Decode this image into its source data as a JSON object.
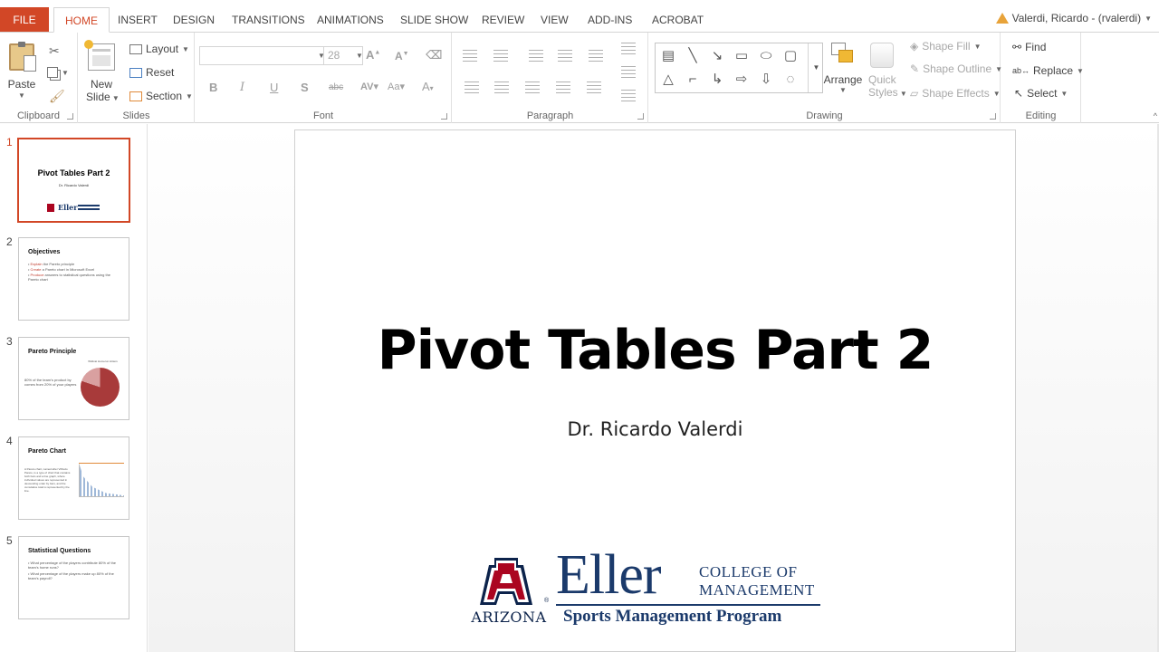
{
  "tabs": {
    "file": "FILE",
    "items": [
      "HOME",
      "INSERT",
      "DESIGN",
      "TRANSITIONS",
      "ANIMATIONS",
      "SLIDE SHOW",
      "REVIEW",
      "VIEW",
      "ADD-INS",
      "ACROBAT"
    ],
    "active": "HOME"
  },
  "user": {
    "name": "Valerdi, Ricardo - (rvalerdi)"
  },
  "ribbon": {
    "clipboard": {
      "label": "Clipboard",
      "paste": "Paste"
    },
    "slides": {
      "label": "Slides",
      "new_slide_line1": "New",
      "new_slide_line2": "Slide",
      "layout": "Layout",
      "reset": "Reset",
      "section": "Section"
    },
    "font": {
      "label": "Font",
      "font_name": "",
      "font_size": "28"
    },
    "paragraph": {
      "label": "Paragraph"
    },
    "drawing": {
      "label": "Drawing",
      "arrange": "Arrange",
      "quick_styles_line1": "Quick",
      "quick_styles_line2": "Styles",
      "shape_fill": "Shape Fill",
      "shape_outline": "Shape Outline",
      "shape_effects": "Shape Effects"
    },
    "editing": {
      "label": "Editing",
      "find": "Find",
      "replace": "Replace",
      "select": "Select"
    }
  },
  "thumbnails": [
    {
      "number": "1",
      "title": "Pivot Tables Part 2",
      "subtitle": "Dr. Ricardo Valerdi"
    },
    {
      "number": "2",
      "title": "Objectives",
      "bullets": [
        {
          "keyword": "Explain",
          "rest": " the Pareto principle"
        },
        {
          "keyword": "Create",
          "rest": " a Pareto chart in Microsoft Excel"
        },
        {
          "keyword": "Produce",
          "rest": " answers to statistical questions using the Pareto chart"
        }
      ]
    },
    {
      "number": "3",
      "title": "Pareto Principle",
      "text": "80% of the team's product by comes from 20% of your players",
      "chart_title": "Wildcat Homerun Hitters"
    },
    {
      "number": "4",
      "title": "Pareto Chart",
      "text": "A Pareto chart, named after Vilfredo Pareto, is a type of chart that contains both bars and a line graph, where individual values are represented in descending order by bars, and the cumulative total is represented by the line."
    },
    {
      "number": "5",
      "title": "Statistical Questions",
      "bullets": [
        "What percentage of the players contribute 80% of the team's home runs?",
        "What percentage of the players make up 80% of the team's payroll?"
      ]
    }
  ],
  "slide": {
    "title": "Pivot Tables Part 2",
    "subtitle": "Dr. Ricardo Valerdi"
  },
  "logo": {
    "university": "ARIZONA",
    "brand": "Eller",
    "college_line1": "COLLEGE OF",
    "college_line2": "MANAGEMENT",
    "program": "Sports Management Program"
  },
  "colors": {
    "accent": "#d24726",
    "navy": "#1b3a6b",
    "arizona_red": "#ab0520",
    "arizona_navy": "#0c234b"
  }
}
